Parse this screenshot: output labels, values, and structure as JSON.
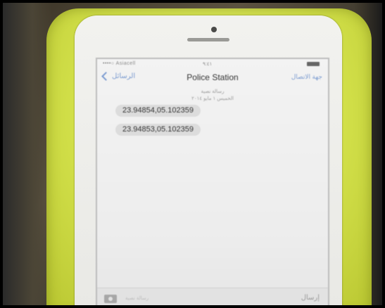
{
  "status_bar": {
    "carrier": "••••○ Asiacell",
    "time": "٩:٤١"
  },
  "nav": {
    "back_label": "الرسائل",
    "title": "Police Station",
    "details_label": "جهة الاتصال"
  },
  "conversation": {
    "meta_line_1": "رسالة نصية",
    "meta_line_2": "الخميس ١ مايو ٢٠١٤",
    "messages": [
      {
        "text": "23.94854,05.102359"
      },
      {
        "text": "23.94853,05.102359"
      }
    ]
  },
  "composer": {
    "placeholder": "رسالة نصية",
    "send_label": "إرسال",
    "camera_icon": "camera-icon"
  },
  "colors": {
    "case": "#d4e24b",
    "link": "#7b9bd0",
    "bubble": "#dcdcdc"
  }
}
